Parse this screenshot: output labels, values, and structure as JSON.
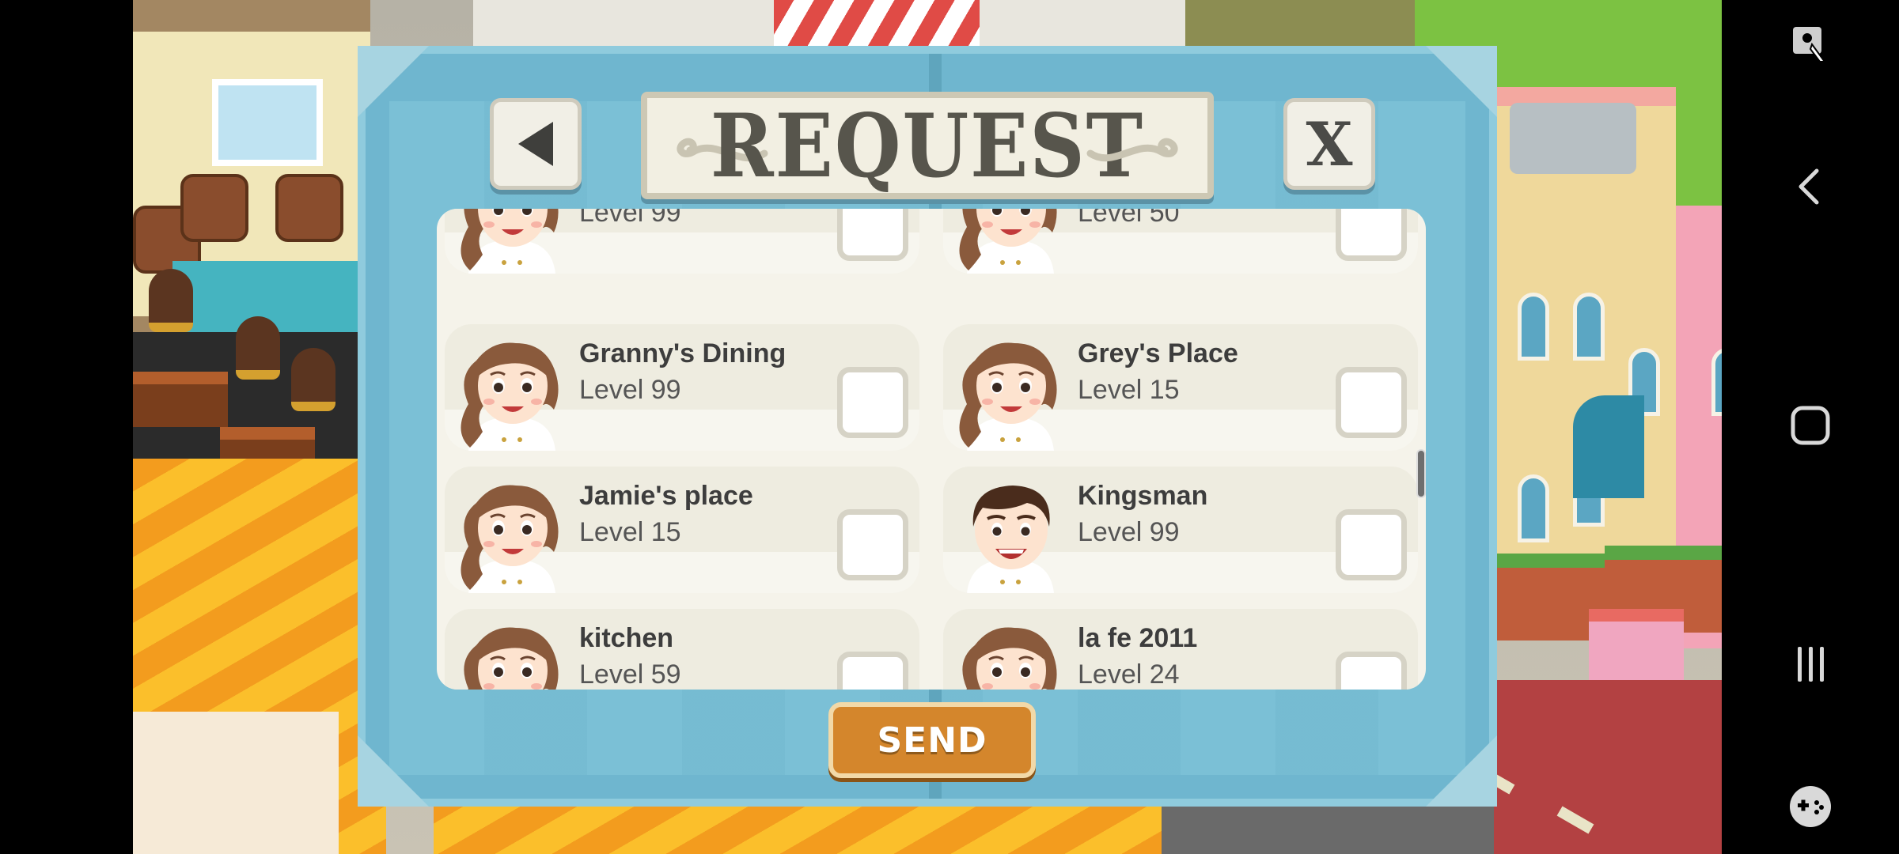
{
  "dialog": {
    "title": "REQUEST",
    "close_label": "X",
    "send_label": "SEND"
  },
  "friends": [
    {
      "name": "",
      "level": "Level 99",
      "gender": "female",
      "checked": false
    },
    {
      "name": "",
      "level": "Level 50",
      "gender": "female",
      "checked": false
    },
    {
      "name": "Granny's Dining",
      "level": "Level 99",
      "gender": "female",
      "checked": false
    },
    {
      "name": "Grey's Place",
      "level": "Level 15",
      "gender": "female",
      "checked": false
    },
    {
      "name": "Jamie's place",
      "level": "Level 15",
      "gender": "female",
      "checked": false
    },
    {
      "name": "Kingsman",
      "level": "Level 99",
      "gender": "male",
      "checked": false
    },
    {
      "name": "kitchen",
      "level": "Level 59",
      "gender": "female",
      "checked": false
    },
    {
      "name": "la fe 2011",
      "level": "Level 24",
      "gender": "female",
      "checked": false
    }
  ],
  "colors": {
    "dialog_bg": "#6fb6cf",
    "send_button": "#d4862c",
    "panel": "#f5f3ea"
  },
  "navbar": {
    "icons": [
      "screen-touch-icon",
      "back-chevron-icon",
      "home-square-icon",
      "recent-apps-icon",
      "game-controller-icon"
    ]
  }
}
